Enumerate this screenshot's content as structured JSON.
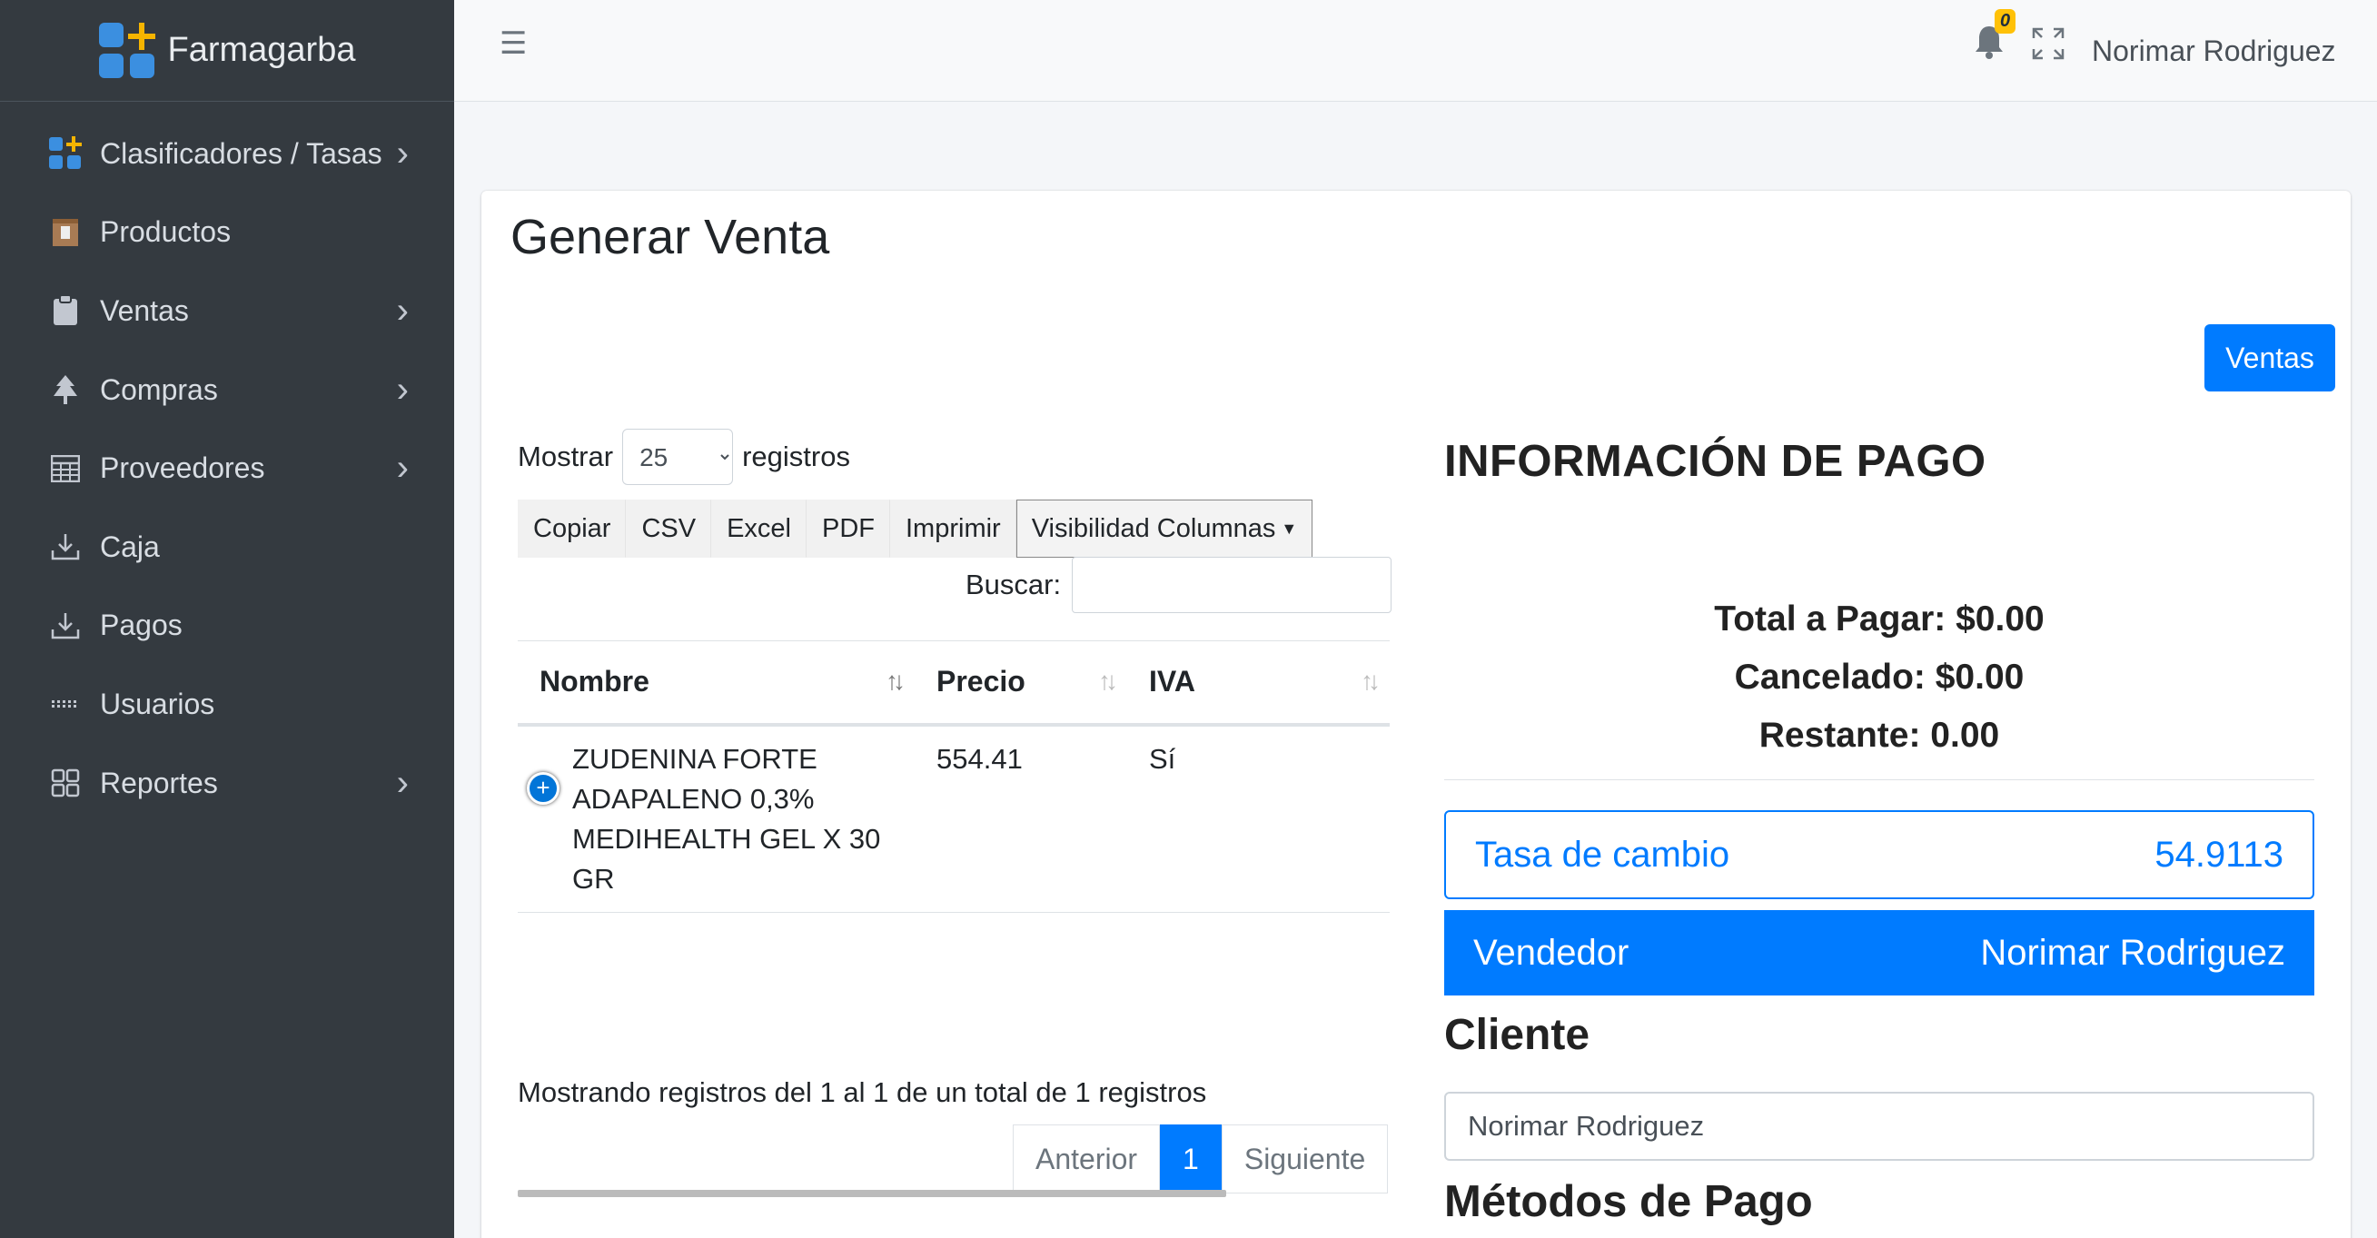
{
  "brand": {
    "name": "Farmagarba"
  },
  "sidebar": {
    "items": [
      {
        "label": "Clasificadores / Tasas",
        "icon": "grid-plus-icon",
        "has_children": true
      },
      {
        "label": "Productos",
        "icon": "box-icon",
        "has_children": false
      },
      {
        "label": "Ventas",
        "icon": "clipboard-icon",
        "has_children": true
      },
      {
        "label": "Compras",
        "icon": "tree-icon",
        "has_children": true
      },
      {
        "label": "Proveedores",
        "icon": "table-icon",
        "has_children": true
      },
      {
        "label": "Caja",
        "icon": "download-icon",
        "has_children": false
      },
      {
        "label": "Pagos",
        "icon": "download-icon",
        "has_children": false
      },
      {
        "label": "Usuarios",
        "icon": "ellipsis-icon",
        "has_children": false
      },
      {
        "label": "Reportes",
        "icon": "dashboard-icon",
        "has_children": true
      }
    ]
  },
  "header": {
    "notifications_count": "0",
    "user_name": "Norimar Rodriguez"
  },
  "page": {
    "title": "Generar Venta",
    "ventas_button": "Ventas"
  },
  "table_controls": {
    "show_label": "Mostrar",
    "page_length": "25",
    "records_label": "registros",
    "buttons": [
      "Copiar",
      "CSV",
      "Excel",
      "PDF",
      "Imprimir",
      "Visibilidad Columnas"
    ],
    "search_label": "Buscar:"
  },
  "table": {
    "headers": [
      "Nombre",
      "Precio",
      "IVA"
    ],
    "rows": [
      {
        "nombre": "ZUDENINA FORTE ADAPALENO 0,3% MEDIHEALTH GEL X 30 GR",
        "precio": "554.41",
        "iva": "Sí"
      }
    ],
    "info": "Mostrando registros del 1 al 1 de un total de 1 registros",
    "pagination": {
      "prev": "Anterior",
      "current": "1",
      "next": "Siguiente"
    }
  },
  "payment": {
    "title": "INFORMACIÓN DE PAGO",
    "total": "Total a Pagar: $0.00",
    "cancelado": "Cancelado: $0.00",
    "restante": "Restante: 0.00",
    "rate_label": "Tasa de cambio",
    "rate_value": "54.9113",
    "seller_label": "Vendedor",
    "seller_value": "Norimar Rodriguez",
    "client_label": "Cliente",
    "client_value": "Norimar Rodriguez",
    "methods_label": "Métodos de Pago"
  },
  "colors": {
    "primary": "#007bff",
    "sidebar": "#343a40",
    "badge": "#ffc107"
  }
}
